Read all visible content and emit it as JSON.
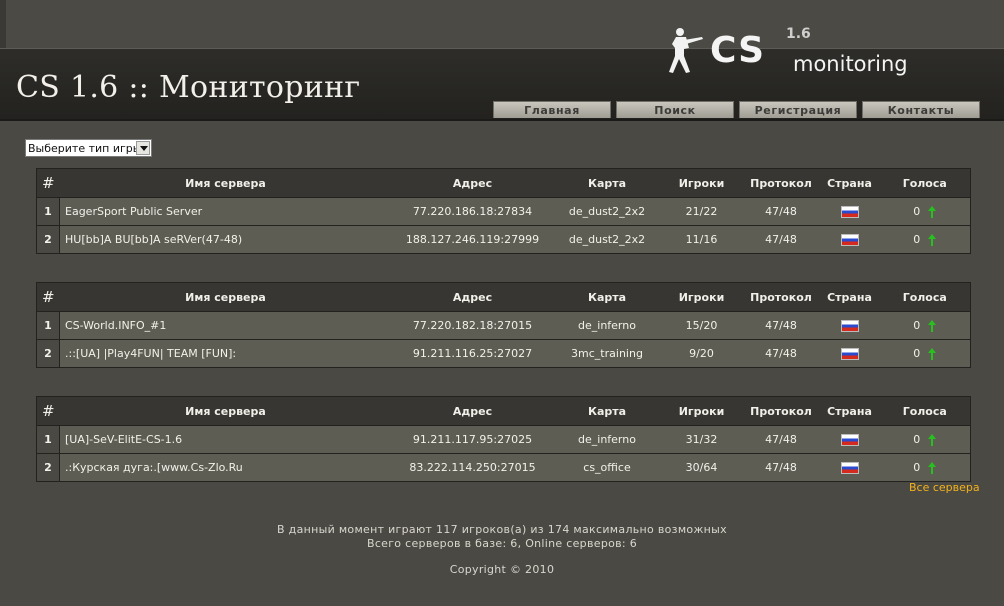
{
  "site": {
    "title": "CS 1.6 :: Мониторинг",
    "logo_cs": "CS",
    "logo_version": "1.6",
    "logo_monitoring": "monitoring"
  },
  "nav": [
    {
      "label": "Главная"
    },
    {
      "label": "Поиск"
    },
    {
      "label": "Регистрация"
    },
    {
      "label": "Контакты"
    }
  ],
  "game_select": {
    "value": "Выберите тип игры"
  },
  "columns": {
    "num": "#",
    "name": "Имя сервера",
    "address": "Адрес",
    "map": "Карта",
    "players": "Игроки",
    "protocol": "Протокол",
    "country": "Страна",
    "votes": "Голоса"
  },
  "tables": [
    {
      "rows": [
        {
          "num": "1",
          "name": "EagerSport Public Server",
          "address": "77.220.186.18:27834",
          "map": "de_dust2_2x2",
          "players": "21/22",
          "protocol": "47/48",
          "country": "ru-flag",
          "votes": "0"
        },
        {
          "num": "2",
          "name": "HU[bb]A BU[bb]A seRVer(47-48)",
          "address": "188.127.246.119:27999",
          "map": "de_dust2_2x2",
          "players": "11/16",
          "protocol": "47/48",
          "country": "ru-flag",
          "votes": "0"
        }
      ]
    },
    {
      "rows": [
        {
          "num": "1",
          "name": "CS-World.INFO_#1",
          "address": "77.220.182.18:27015",
          "map": "de_inferno",
          "players": "15/20",
          "protocol": "47/48",
          "country": "ru-flag",
          "votes": "0"
        },
        {
          "num": "2",
          "name": ".::[UA] |Play4FUN| TEAM [FUN]:",
          "address": "91.211.116.25:27027",
          "map": "3mc_training",
          "players": "9/20",
          "protocol": "47/48",
          "country": "ru-flag",
          "votes": "0"
        }
      ]
    },
    {
      "rows": [
        {
          "num": "1",
          "name": "[UA]-SeV-ElitE-CS-1.6",
          "address": "91.211.117.95:27025",
          "map": "de_inferno",
          "players": "31/32",
          "protocol": "47/48",
          "country": "ru-flag",
          "votes": "0"
        },
        {
          "num": "2",
          "name": ".:Курская дуга:.[www.Cs-Zlo.Ru",
          "address": "83.222.114.250:27015",
          "map": "cs_office",
          "players": "30/64",
          "protocol": "47/48",
          "country": "ru-flag",
          "votes": "0"
        }
      ]
    }
  ],
  "all_servers_link": "Все сервера",
  "footer": {
    "online_line": "В данный момент играют 117 игроков(а) из 174 максимально возможных",
    "servers_line": "Всего серверов в базе: 6, Online серверов: 6",
    "copyright": "Copyright © 2010"
  },
  "colors": {
    "background": "#4a4944",
    "row_bg": "#5e5d53",
    "link_accent": "#f4b21c",
    "vote_arrow": "#27c01f"
  }
}
